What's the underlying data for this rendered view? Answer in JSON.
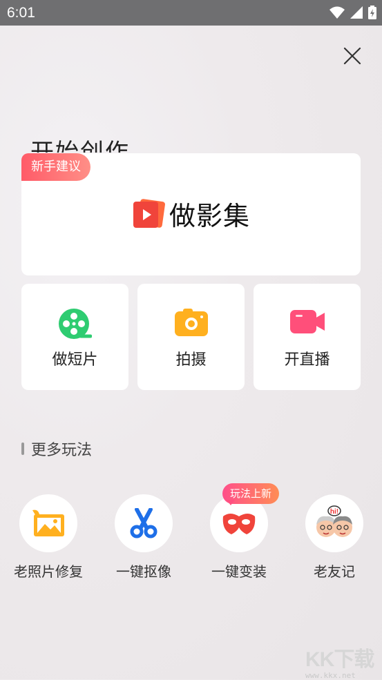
{
  "status_bar": {
    "time": "6:01"
  },
  "header": {
    "title": "开始创作"
  },
  "main_card": {
    "badge": "新手建议",
    "label": "做影集"
  },
  "tiles": [
    {
      "label": "做短片",
      "icon": "film-reel-icon"
    },
    {
      "label": "拍摄",
      "icon": "camera-icon"
    },
    {
      "label": "开直播",
      "icon": "video-camera-icon"
    }
  ],
  "more": {
    "title": "更多玩法",
    "items": [
      {
        "label": "老照片修复",
        "icon": "photo-restore-icon"
      },
      {
        "label": "一键抠像",
        "icon": "scissors-icon"
      },
      {
        "label": "一键变装",
        "icon": "mask-icon",
        "badge": "玩法上新"
      },
      {
        "label": "老友记",
        "icon": "old-friends-icon"
      }
    ]
  },
  "watermark": {
    "logo": "KK下载",
    "url": "www.kkx.net"
  },
  "colors": {
    "badge": "#ff5b68",
    "green": "#2ecc71",
    "orange": "#ffb01f",
    "pink": "#ff4f7a",
    "blue": "#1e6fe8",
    "red": "#f0443b"
  }
}
